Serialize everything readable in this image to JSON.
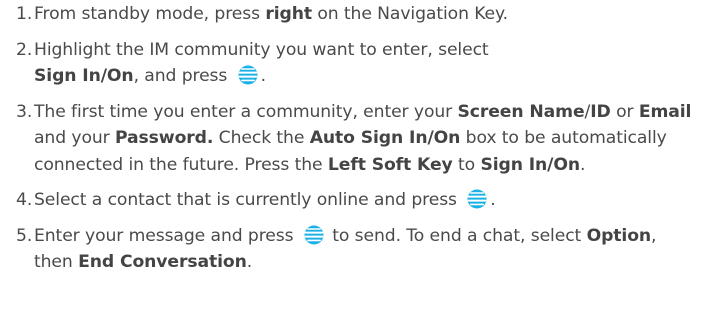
{
  "icons": {
    "select_key": "att-globe-select-key-icon",
    "select_key_color": "#1bb0e6"
  },
  "steps": [
    {
      "number": "1.",
      "parts": [
        {
          "t": "From standby mode, press "
        },
        {
          "t": "right",
          "b": true
        },
        {
          "t": " on the Navigation Key."
        }
      ]
    },
    {
      "number": "2.",
      "parts": [
        {
          "t": "Highlight the IM community you want to enter, select "
        },
        {
          "br": true
        },
        {
          "t": "Sign In/On",
          "b": true
        },
        {
          "t": ", and press "
        },
        {
          "icon": "select-key"
        },
        {
          "t": "."
        }
      ]
    },
    {
      "number": "3.",
      "parts": [
        {
          "t": "The first time you enter a community, enter your "
        },
        {
          "t": "Screen Name",
          "b": true
        },
        {
          "t": "/"
        },
        {
          "t": "ID",
          "b": true
        },
        {
          "t": " or "
        },
        {
          "t": "Email",
          "b": true
        },
        {
          "t": " and your "
        },
        {
          "t": "Password.",
          "b": true
        },
        {
          "t": " Check the "
        },
        {
          "t": "Auto Sign In/On",
          "b": true
        },
        {
          "t": " box to be automatically connected in the future. Press the "
        },
        {
          "t": "Left Soft Key",
          "b": true
        },
        {
          "t": " to "
        },
        {
          "t": "Sign In/On",
          "b": true
        },
        {
          "t": "."
        }
      ]
    },
    {
      "number": "4.",
      "parts": [
        {
          "t": "Select a contact that is currently online and press "
        },
        {
          "icon": "select-key"
        },
        {
          "t": "."
        }
      ]
    },
    {
      "number": "5.",
      "parts": [
        {
          "t": "Enter your message and press "
        },
        {
          "icon": "select-key"
        },
        {
          "t": " to send. To end a chat, select "
        },
        {
          "t": "Option",
          "b": true
        },
        {
          "t": ", then "
        },
        {
          "t": "End Conversation",
          "b": true
        },
        {
          "t": "."
        }
      ]
    }
  ]
}
